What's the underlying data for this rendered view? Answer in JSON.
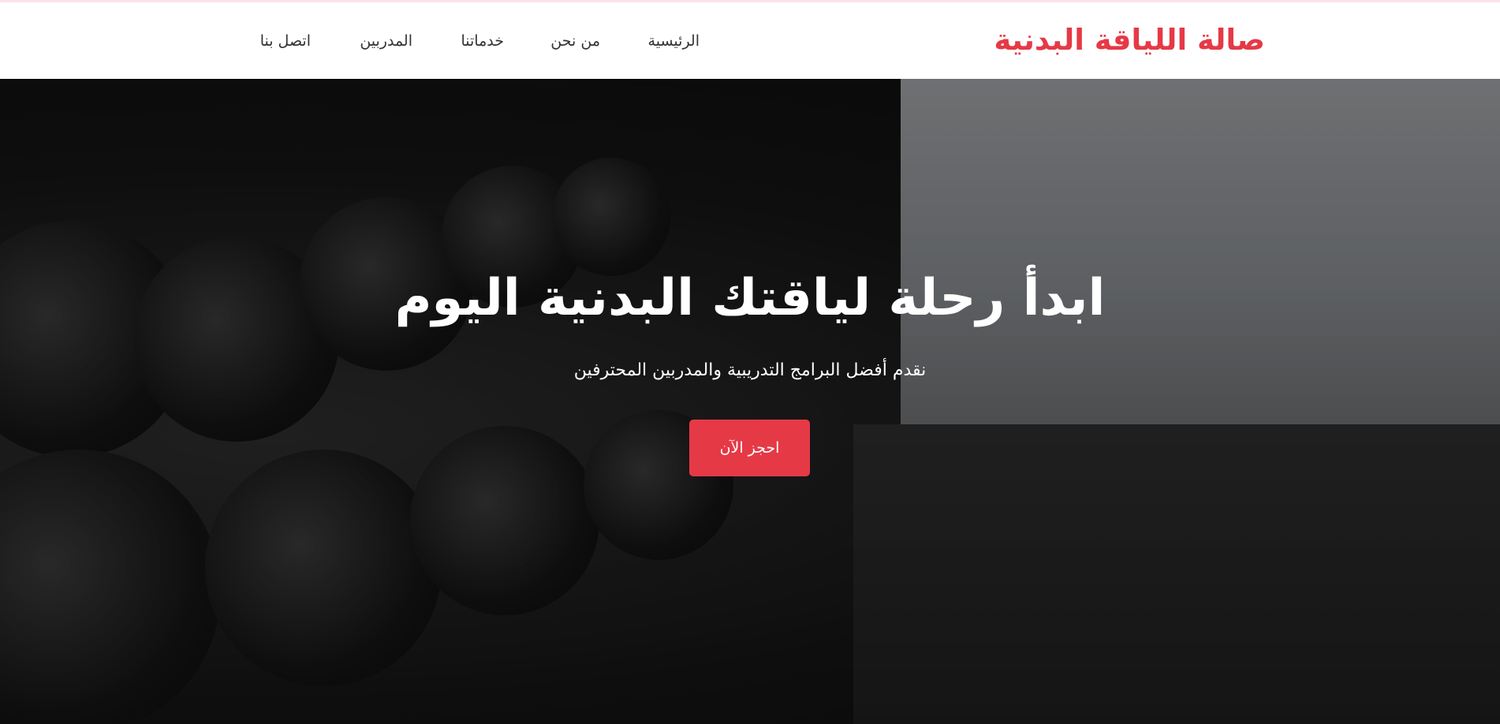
{
  "brand": {
    "name": "صالة اللياقة البدنية",
    "color": "#e63946"
  },
  "nav": {
    "items": [
      {
        "label": "الرئيسية"
      },
      {
        "label": "من نحن"
      },
      {
        "label": "خدماتنا"
      },
      {
        "label": "المدربين"
      },
      {
        "label": "اتصل بنا"
      }
    ]
  },
  "hero": {
    "title": "ابدأ رحلة لياقتك البدنية اليوم",
    "subtitle": "نقدم أفضل البرامج التدريبية والمدربين المحترفين",
    "cta_label": "احجز الآن",
    "background": "gym-dumbbell-rack-photo"
  },
  "colors": {
    "accent": "#e63946",
    "text": "#333333",
    "hero_text": "#ffffff"
  }
}
